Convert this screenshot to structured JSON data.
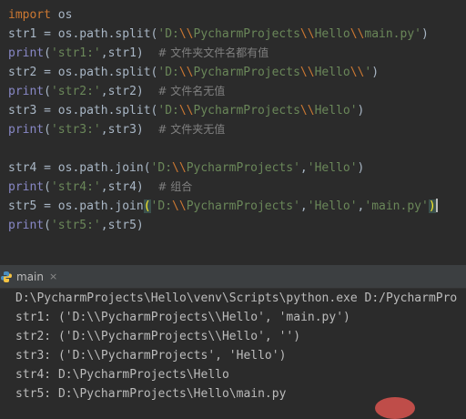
{
  "editor": {
    "lines": [
      {
        "kw": "import",
        "rest": " os"
      },
      {
        "pre": "str1 = os.path.split(",
        "s1": "'D:",
        "e1": "\\\\",
        "s2": "PycharmProjects",
        "e2": "\\\\",
        "s3": "Hello",
        "e3": "\\\\",
        "s4": "main.py'",
        "post": ")"
      },
      {
        "fn": "print",
        "open": "(",
        "str": "'str1:'",
        "rest": ",str1)  ",
        "comment": "# 文件夹文件名都有值"
      },
      {
        "pre": "str2 = os.path.split(",
        "s1": "'D:",
        "e1": "\\\\",
        "s2": "PycharmProjects",
        "e2": "\\\\",
        "s3": "Hello",
        "e3": "\\\\",
        "s4": "'",
        "post": ")"
      },
      {
        "fn": "print",
        "open": "(",
        "str": "'str2:'",
        "rest": ",str2)  ",
        "comment": "# 文件名无值"
      },
      {
        "pre": "str3 = os.path.split(",
        "s1": "'D:",
        "e1": "\\\\",
        "s2": "PycharmProjects",
        "e2": "\\\\",
        "s3": "Hello'",
        "post": ")"
      },
      {
        "fn": "print",
        "open": "(",
        "str": "'str3:'",
        "rest": ",str3)  ",
        "comment": "# 文件夹无值"
      },
      {
        "pre": "str4 = os.path.join(",
        "s1": "'D:",
        "e1": "\\\\",
        "s2": "PycharmProjects'",
        "mid": ",",
        "s3": "'Hello'",
        "post": ")"
      },
      {
        "fn": "print",
        "open": "(",
        "str": "'str4:'",
        "rest": ",str4)  ",
        "comment": "# 组合"
      },
      {
        "pre": "str5 = os.path.join",
        "open": "(",
        "s1": "'D:",
        "e1": "\\\\",
        "s2": "PycharmProjects'",
        "mid1": ",",
        "s3": "'Hello'",
        "mid2": ",",
        "s4": "'main.py'",
        "close": ")"
      },
      {
        "fn": "print",
        "open": "(",
        "str": "'str5:'",
        "rest": ",str5)"
      }
    ]
  },
  "run_panel": {
    "tab_label": "main",
    "close_glyph": "×",
    "output": [
      "D:\\PycharmProjects\\Hello\\venv\\Scripts\\python.exe D:/PycharmPro",
      "str1: ('D:\\\\PycharmProjects\\\\Hello', 'main.py')",
      "str2: ('D:\\\\PycharmProjects\\\\Hello', '')",
      "str3: ('D:\\\\PycharmProjects', 'Hello')",
      "str4: D:\\PycharmProjects\\Hello",
      "str5: D:\\PycharmProjects\\Hello\\main.py"
    ]
  },
  "colors": {
    "background": "#2b2b2b",
    "keyword": "#cc7832",
    "string": "#6a8759",
    "builtin": "#8888c6",
    "comment": "#808080",
    "text": "#a9b7c6"
  },
  "icons": {
    "run_tab": "python-icon",
    "close": "close-icon"
  }
}
